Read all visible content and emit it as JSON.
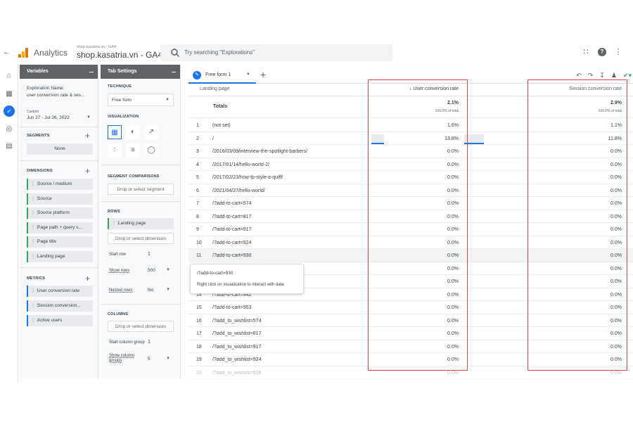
{
  "header": {
    "app_name": "Analytics",
    "property_sub": "shop.kasatria.vn - GA4",
    "property_name": "shop.kasatria.vn - GA4",
    "search_placeholder": "Try searching \"Explorations\""
  },
  "variables": {
    "title": "Variables",
    "exploration_name_label": "Exploration Name:",
    "exploration_name": "user conversion rate & ses...",
    "date_custom_label": "Custom",
    "date_range": "Jun 27 - Jul 26, 2022",
    "segments_title": "SEGMENTS",
    "segments_none": "None",
    "dimensions_title": "DIMENSIONS",
    "dimensions": [
      "Source / medium",
      "Source",
      "Source platform",
      "Page path + query s...",
      "Page title",
      "Landing page"
    ],
    "metrics_title": "METRICS",
    "metrics": [
      "User conversion rate",
      "Session conversion...",
      "Active users"
    ]
  },
  "tab_settings": {
    "title": "Tab Settings",
    "technique_title": "TECHNIQUE",
    "technique": "Free form",
    "visualization_title": "VISUALIZATION",
    "segment_comparisons_title": "SEGMENT COMPARISONS",
    "segment_drop": "Drop or select segment",
    "rows_title": "ROWS",
    "rows_dimension": "Landing page",
    "dimension_drop": "Drop or select dimension",
    "start_row_label": "Start row",
    "start_row": "1",
    "show_rows_label": "Show rows",
    "show_rows": "500",
    "nested_rows_label": "Nested rows",
    "nested_rows": "No",
    "columns_title": "COLUMNS",
    "column_drop": "Drop or select dimension",
    "start_column_group_label": "Start column group",
    "start_column_group": "1",
    "show_column_groups_label": "Show column groups",
    "show_column_groups": "5"
  },
  "main": {
    "tab_label": "Free form 1",
    "col_dimension": "Landing page",
    "col_metric_1": "↓ User conversion rate",
    "col_metric_2": "Session conversion rate",
    "totals_label": "Totals",
    "total_1": "2.1%",
    "total_1_pct": "100.0% of total",
    "total_2": "2.9%",
    "total_2_pct": "100.0% of total",
    "rows": [
      {
        "n": "1",
        "page": "(not set)",
        "v1": "1.6%",
        "v2": "1.1%"
      },
      {
        "n": "2",
        "page": "/",
        "v1": "13.8%",
        "v2": "11.8%"
      },
      {
        "n": "3",
        "page": "/2016/03/09/interview-the-spotlight-barbers/",
        "v1": "0.0%",
        "v2": "0.0%"
      },
      {
        "n": "4",
        "page": "/2017/01/14/hello-world-2/",
        "v1": "0.0%",
        "v2": "0.0%"
      },
      {
        "n": "5",
        "page": "/2017/02/23/how-to-style-a-quiff/",
        "v1": "0.0%",
        "v2": "0.0%"
      },
      {
        "n": "6",
        "page": "/2021/04/27/hello-world/",
        "v1": "0.0%",
        "v2": "0.0%"
      },
      {
        "n": "7",
        "page": "/?add-to-cart=574",
        "v1": "0.0%",
        "v2": "0.0%"
      },
      {
        "n": "8",
        "page": "/?add-to-cart=817",
        "v1": "0.0%",
        "v2": "0.0%"
      },
      {
        "n": "9",
        "page": "/?add-to-cart=917",
        "v1": "0.0%",
        "v2": "0.0%"
      },
      {
        "n": "10",
        "page": "/?add-to-cart=924",
        "v1": "0.0%",
        "v2": "0.0%"
      },
      {
        "n": "11",
        "page": "/?add-to-cart=930",
        "v1": "0.0%",
        "v2": "0.0%"
      },
      {
        "n": "",
        "page": "",
        "v1": "0.0%",
        "v2": "0.0%"
      },
      {
        "n": "",
        "page": "",
        "v1": "0.0%",
        "v2": "0.0%"
      },
      {
        "n": "14",
        "page": "/?add-to-cart=942",
        "v1": "0.0%",
        "v2": "0.0%"
      },
      {
        "n": "15",
        "page": "/?add-to-cart=953",
        "v1": "0.0%",
        "v2": "0.0%"
      },
      {
        "n": "16",
        "page": "/?add_to_wishlist=574",
        "v1": "0.0%",
        "v2": "0.0%"
      },
      {
        "n": "17",
        "page": "/?add_to_wishlist=817",
        "v1": "0.0%",
        "v2": "0.0%"
      },
      {
        "n": "18",
        "page": "/?add_to_wishlist=917",
        "v1": "0.0%",
        "v2": "0.0%"
      },
      {
        "n": "19",
        "page": "/?add_to_wishlist=924",
        "v1": "0.0%",
        "v2": "0.0%"
      },
      {
        "n": "20",
        "page": "/?add_to_wishlist=928",
        "v1": "0.0%",
        "v2": "0.0%"
      }
    ],
    "tooltip_title": "/?add-to-cart=930",
    "tooltip_hint": "Right click on visualization to interact with data"
  },
  "colors": {
    "accent": "#1a73e8",
    "highlight_box": "#e0433b",
    "panel_header": "#5f6368"
  }
}
